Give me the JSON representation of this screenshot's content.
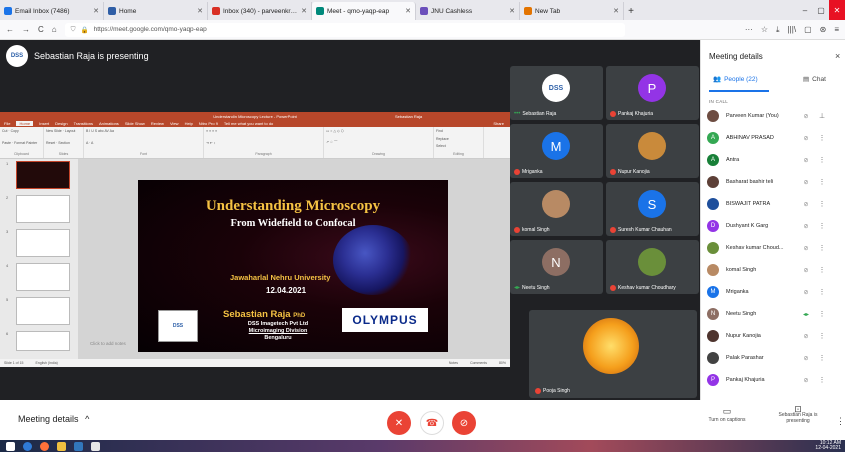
{
  "browser": {
    "tabs": [
      {
        "label": "Email Inbox (7486)",
        "color": "#1a73e8"
      },
      {
        "label": "Home",
        "color": "#2f5ea6"
      },
      {
        "label": "Inbox (340) - parveenkr@gm...",
        "color": "#d93025"
      },
      {
        "label": "Meet - qmo-yaqp-eap",
        "color": "#00897b",
        "active": true
      },
      {
        "label": "JNU Cashless",
        "color": "#6b4fbb"
      },
      {
        "label": "New Tab",
        "color": "#e37400"
      }
    ],
    "url": "https://meet.google.com/qmo-yaqp-eap",
    "new_tab_glyph": "+",
    "nav_glyphs": [
      "←",
      "→",
      "C",
      "⌂"
    ],
    "right_glyphs": [
      "···",
      "☆",
      "⤓",
      "|||\\",
      "▢",
      "⊛",
      "≡"
    ]
  },
  "meet": {
    "presenter_text": "Sebastian Raja is presenting",
    "presenter_avatar_text": "DSS",
    "bottom_label": "Meeting details",
    "bottom_caret": "^",
    "captions_label": "Turn on captions",
    "captions_glyph": "▭",
    "presenting_label": "Sebastian Raja is presenting",
    "presenting_glyph": "⊡",
    "more_glyph": "⋮",
    "mic_glyph": "🎙",
    "end_glyph": "☎",
    "cam_glyph": "⊘"
  },
  "ppt": {
    "window_title": "Understandin Microscopy Lecture - PowerPoint",
    "user": "Sebastian Raja",
    "tabs": [
      "File",
      "Home",
      "Insert",
      "Design",
      "Transitions",
      "Animations",
      "Slide Show",
      "Review",
      "View",
      "Help",
      "Nitro Pro 9",
      "Tell me what you want to do"
    ],
    "share_label": "Share",
    "ribbon_groups": [
      "Clipboard",
      "Slides",
      "Font",
      "Paragraph",
      "Drawing",
      "Editing"
    ],
    "ribbon_items": {
      "clipboard": [
        "Cut",
        "Copy",
        "Format Painter",
        "Paste"
      ],
      "slides": [
        "New Slide",
        "Layout",
        "Reset",
        "Section"
      ],
      "editing": [
        "Find",
        "Replace",
        "Select"
      ]
    },
    "thumb_numbers": [
      "1",
      "2",
      "3",
      "4",
      "5",
      "6"
    ],
    "notes_placeholder": "Click to add notes",
    "status_left": "Slide 1 of 15",
    "status_lang": "English (India)",
    "status_notes": "Notes",
    "status_comments": "Comments",
    "zoom": "80%"
  },
  "slide": {
    "title": "Understanding Microscopy",
    "subtitle": "From Widefield to Confocal",
    "university": "Jawaharlal Nehru University",
    "date": "12.04.2021",
    "speaker": "Sebastian Raja",
    "speaker_suffix": "PhD",
    "company_line1": "DSS Imagetech Pvt Ltd",
    "company_line2": "Microimaging Division",
    "company_line3": "Bengaluru",
    "dss_logo": "DSS",
    "olympus_logo": "OLYMPUS"
  },
  "tiles": [
    {
      "name": "Sebastian Raja",
      "initial": "DSS",
      "color": "#ffffff",
      "text_color": "#2c5fa8",
      "state": "speaking"
    },
    {
      "name": "Pankaj Khajuria",
      "initial": "P",
      "color": "#9334e6",
      "state": "muted"
    },
    {
      "name": "Mriganka",
      "initial": "M",
      "color": "#1a73e8",
      "state": "muted"
    },
    {
      "name": "Nupur Kanojia",
      "initial": "",
      "color": "#c98a3b",
      "state": "muted"
    },
    {
      "name": "komal Singh",
      "initial": "",
      "color": "#b88a64",
      "state": "muted"
    },
    {
      "name": "Suresh Kumar Chauhan",
      "initial": "S",
      "color": "#1a73e8",
      "state": "muted"
    },
    {
      "name": "Neetu Singh",
      "initial": "N",
      "color": "#8d6e63",
      "state": "talking"
    },
    {
      "name": "Keshav kumar Choudhary",
      "initial": "",
      "color": "#6a8f3a",
      "state": "muted"
    }
  ],
  "big_tile": {
    "name": "Pooja Singh"
  },
  "panel": {
    "title": "Meeting details",
    "close_glyph": "×",
    "people_tab": "People (22)",
    "chat_tab": "Chat",
    "section": "IN CALL",
    "participants": [
      {
        "name": "Parveen Kumar (You)",
        "initial": "",
        "color": "#6d4c41",
        "mic": "muted",
        "action": "pin"
      },
      {
        "name": "ABHINAV PRASAD",
        "initial": "A",
        "color": "#34a853",
        "mic": "muted",
        "action": "more"
      },
      {
        "name": "Antra",
        "initial": "A",
        "color": "#188038",
        "mic": "muted",
        "action": "more"
      },
      {
        "name": "Basharat bashir teli",
        "initial": "",
        "color": "#5d4037",
        "mic": "muted",
        "action": "more"
      },
      {
        "name": "BISWAJIT PATRA",
        "initial": "",
        "color": "#1e4f9c",
        "mic": "muted",
        "action": "more"
      },
      {
        "name": "Dushyant K Garg",
        "initial": "D",
        "color": "#9334e6",
        "mic": "muted",
        "action": "more"
      },
      {
        "name": "Keshav kumar Choud...",
        "initial": "",
        "color": "#6a8f3a",
        "mic": "muted",
        "action": "more"
      },
      {
        "name": "komal Singh",
        "initial": "",
        "color": "#b88a64",
        "mic": "muted",
        "action": "more"
      },
      {
        "name": "Mriganka",
        "initial": "M",
        "color": "#1a73e8",
        "mic": "muted",
        "action": "more"
      },
      {
        "name": "Neetu Singh",
        "initial": "N",
        "color": "#8d6e63",
        "mic": "talking",
        "action": "more"
      },
      {
        "name": "Nupur Kanojia",
        "initial": "",
        "color": "#4e342e",
        "mic": "muted",
        "action": "more"
      },
      {
        "name": "Palak Parashar",
        "initial": "",
        "color": "#424242",
        "mic": "muted",
        "action": "more"
      },
      {
        "name": "Pankaj Khajuria",
        "initial": "P",
        "color": "#9334e6",
        "mic": "muted",
        "action": "more"
      }
    ]
  },
  "taskbar": {
    "time": "10:12 AM",
    "date": "12-04-2021"
  }
}
